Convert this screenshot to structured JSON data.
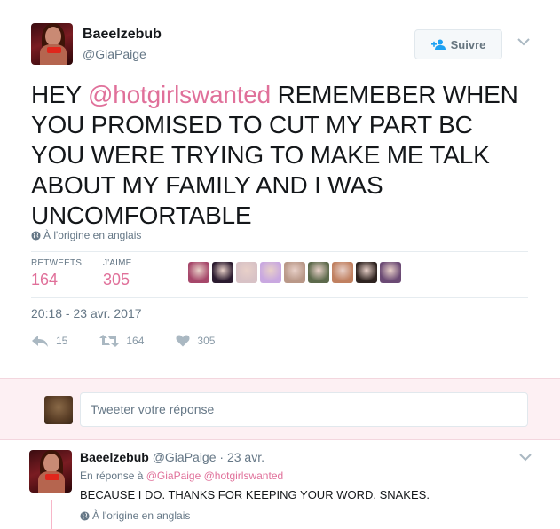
{
  "tweet": {
    "author_name": "Baeelzebub",
    "author_handle": "@GiaPaige",
    "follow_label": "Suivre",
    "text_before": "HEY ",
    "mention": "@hotgirlswanted",
    "text_after": " REMEMEBER WHEN YOU PROMISED TO CUT MY PART BC YOU WERE TRYING TO MAKE ME TALK ABOUT MY FAMILY AND I WAS UNCOMFORTABLE",
    "language_note": "À l'origine en anglais",
    "stats": {
      "retweets_label": "RETWEETS",
      "retweets_value": "164",
      "likes_label": "J'AIME",
      "likes_value": "305"
    },
    "likers": [
      {
        "color": "#a6476a"
      },
      {
        "color": "#2b1b2f"
      },
      {
        "color": "#d8c2c6"
      },
      {
        "color": "#c9a8e0"
      },
      {
        "color": "#b99888"
      },
      {
        "color": "#5d6a4c"
      },
      {
        "color": "#c08060"
      },
      {
        "color": "#2e2320"
      },
      {
        "color": "#6b4a74"
      }
    ],
    "timestamp": "20:18 - 23 avr. 2017",
    "actions": {
      "reply_count": "15",
      "retweet_count": "164",
      "like_count": "305"
    }
  },
  "reply_box": {
    "placeholder": "Tweeter votre réponse"
  },
  "reply": {
    "author_name": "Baeelzebub",
    "author_handle": "@GiaPaige",
    "separator": " · ",
    "time": "23 avr.",
    "in_reply_prefix": "En réponse à ",
    "in_reply_mentions": "@GiaPaige @hotgirlswanted",
    "text": "BECAUSE I DO. THANKS FOR KEEPING YOUR WORD. SNAKES.",
    "language_note": "À l'origine en anglais"
  },
  "colors": {
    "accent": "#e0709a",
    "muted": "#657786",
    "reply_bg": "#fdf0f3"
  }
}
